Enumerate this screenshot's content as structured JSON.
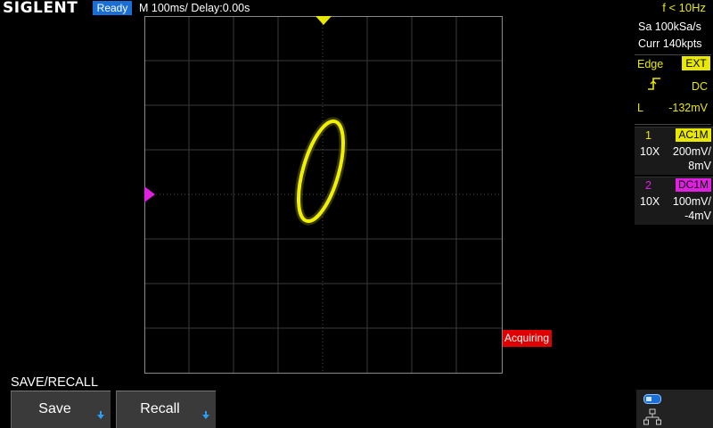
{
  "header": {
    "brand": "SIGLENT",
    "status": "Ready",
    "timebase": "M 100ms/  Delay:0.00s",
    "frequency": "f < 10Hz"
  },
  "acquisition": {
    "sample_rate": "Sa 100kSa/s",
    "memory_depth": "Curr 140kpts",
    "state": "Acquiring"
  },
  "trigger": {
    "type": "Edge",
    "source": "EXT",
    "slope_icon": "rising-edge-icon",
    "coupling": "DC",
    "mode": "L",
    "level": "-132mV"
  },
  "channels": [
    {
      "number": "1",
      "coupling": "AC1M",
      "probe": "10X",
      "scale": "200mV/",
      "offset": "8mV",
      "color": "#e8e800"
    },
    {
      "number": "2",
      "coupling": "DC1M",
      "probe": "10X",
      "scale": "100mV/",
      "offset": "-4mV",
      "color": "#e020e0"
    }
  ],
  "menu": {
    "title": "SAVE/RECALL",
    "keys": [
      {
        "label": "Save",
        "icon": "down-arrow-icon"
      },
      {
        "label": "Recall",
        "icon": "down-arrow-icon"
      }
    ]
  },
  "io_icons": [
    "usb-icon",
    "lan-icon"
  ],
  "colors": {
    "ch1": "#e8e800",
    "ch2": "#e020e0",
    "status_bg": "#1a6fd6",
    "acquiring_bg": "#e00000"
  }
}
